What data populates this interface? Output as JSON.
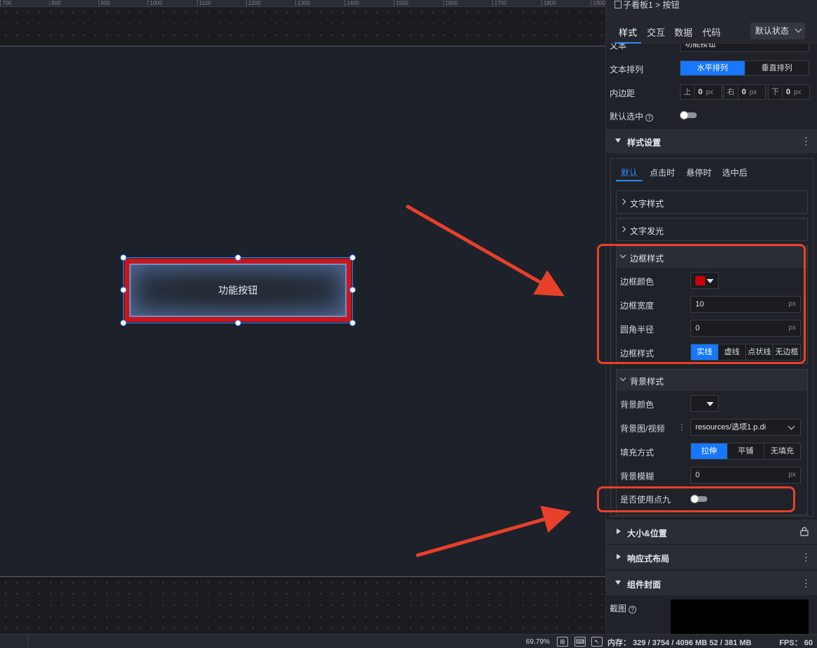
{
  "ruler": {
    "ticks": [
      "700",
      "800",
      "900",
      "1000",
      "1100",
      "1200",
      "1300",
      "1400",
      "1500",
      "1600",
      "1700",
      "1800",
      "1900"
    ]
  },
  "canvas": {
    "button_text": "功能按钮"
  },
  "statusbar": {
    "zoom": "69.79%",
    "memory": "内存： 329 / 3754 / 4096 MB  52 / 381 MB",
    "fps": "FPS： 60"
  },
  "panel": {
    "breadcrumb": {
      "parent": "子看板1",
      "separator": ">",
      "current": "按钮"
    },
    "tabs": [
      "样式",
      "交互",
      "数据",
      "代码"
    ],
    "state_select": "默认状态",
    "text_row": {
      "label": "文本",
      "value": "功能按钮"
    },
    "text_layout": {
      "label": "文本排列",
      "options": [
        "水平排列",
        "垂直排列"
      ],
      "selected": "水平排列"
    },
    "padding": {
      "label": "内边距",
      "items": [
        {
          "key": "上",
          "value": "0",
          "unit": "px"
        },
        {
          "key": "右",
          "value": "0",
          "unit": "px"
        },
        {
          "key": "下",
          "value": "0",
          "unit": "px"
        }
      ]
    },
    "default_selected": {
      "label": "默认选中",
      "help": "?"
    },
    "style_section": {
      "title": "样式设置"
    },
    "sub_tabs": [
      "默认",
      "点击时",
      "悬停时",
      "选中后"
    ],
    "text_style": "文字样式",
    "text_glow": "文字发光",
    "border_style_group": {
      "title": "边框样式",
      "color_label": "边框颜色",
      "color_value": "#cc0000",
      "width_label": "边框宽度",
      "width_value": "10",
      "width_unit": "px",
      "radius_label": "圆角半径",
      "radius_value": "0",
      "radius_unit": "px",
      "style_label": "边框样式",
      "style_options": [
        "实线",
        "虚线",
        "点状线",
        "无边框"
      ],
      "style_selected": "实线"
    },
    "background_group": {
      "title": "背景样式",
      "color_label": "背景颜色",
      "image_label": "背景图/视频",
      "image_value": "resources/选项1.p.di",
      "fill_label": "填充方式",
      "fill_options": [
        "拉伸",
        "平铺",
        "无填充"
      ],
      "fill_selected": "拉伸",
      "blur_label": "背景模糊",
      "blur_value": "0",
      "blur_unit": "px",
      "nine_label": "是否使用点九"
    },
    "size_section": {
      "title": "大小&位置"
    },
    "responsive_section": {
      "title": "响应式布局"
    },
    "cover_section": {
      "title": "组件封面"
    },
    "screenshot_label": "截图"
  },
  "colors": {
    "accent": "#1677ff",
    "annotation": "#e8402a",
    "button_border": "#c8161d"
  }
}
